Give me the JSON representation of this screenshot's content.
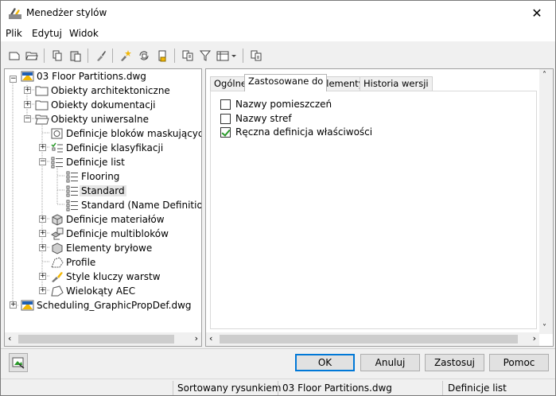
{
  "window": {
    "title": "Menedżer stylów",
    "close_glyph": "✕"
  },
  "menu": {
    "file": "Plik",
    "edit": "Edytuj",
    "view": "Widok"
  },
  "tree": {
    "root": "03 Floor Partitions.dwg",
    "architectural": "Obiekty architektoniczne",
    "documentation": "Obiekty dokumentacji",
    "multipurpose": "Obiekty uniwersalne",
    "mask_block_defs": "Definicje bloków maskujących",
    "classification_defs": "Definicje klasyfikacji",
    "list_defs": "Definicje list",
    "flooring": "Flooring",
    "standard": "Standard",
    "standard_name_def": "Standard (Name Definition)",
    "material_defs": "Definicje materiałów",
    "multiview_block_defs": "Definicje multibloków",
    "mass_elements": "Elementy bryłowe",
    "profile": "Profile",
    "layer_key_styles": "Style kluczy warstw",
    "aec_polygons": "Wielokąty AEC",
    "second_drawing": "Scheduling_GraphicPropDef.dwg"
  },
  "tabs": {
    "general": "Ogólne",
    "applies_to": "Zastosowane do",
    "elements": "Elementy",
    "version_history": "Historia wersji"
  },
  "applies_to": {
    "items": [
      {
        "label": "Nazwy pomieszczeń",
        "checked": false
      },
      {
        "label": "Nazwy stref",
        "checked": false
      },
      {
        "label": "Ręczna definicja właściwości",
        "checked": true
      }
    ]
  },
  "buttons": {
    "ok": "OK",
    "cancel": "Anuluj",
    "apply": "Zastosuj",
    "help": "Pomoc"
  },
  "status": {
    "sort": "Sortowany rysunkiem",
    "drawing": "03 Floor Partitions.dwg",
    "category": "Definicje list"
  },
  "colors": {
    "accent": "#0078d7",
    "check": "#2a9a2a",
    "dwg_blue": "#1f5fb4",
    "dwg_yellow": "#f2b705"
  }
}
